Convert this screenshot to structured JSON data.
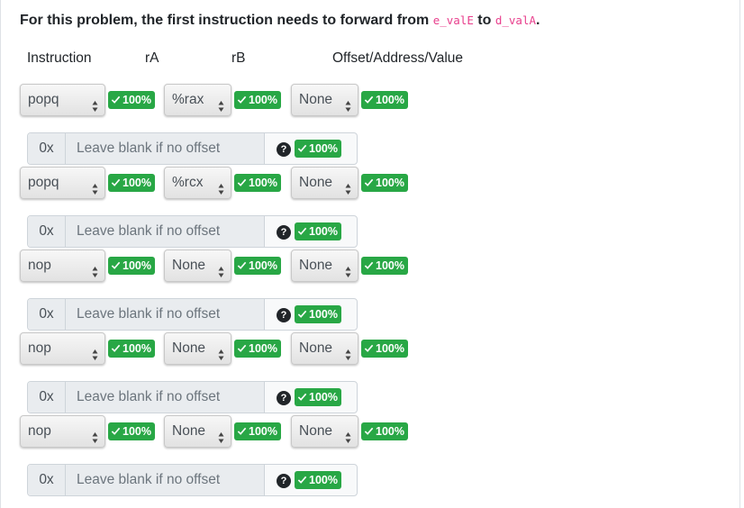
{
  "title": {
    "prefix": "For this problem, the first instruction needs to forward from ",
    "from_code": "e_valE",
    "mid": " to ",
    "to_code": "d_valA",
    "suffix": "."
  },
  "headers": {
    "instruction": "Instruction",
    "ra": "rA",
    "rb": "rB",
    "offset": "Offset/Address/Value"
  },
  "rows": [
    {
      "instruction": "popq",
      "ra": "%rax",
      "rb": "None",
      "offset_prefix": "0x",
      "offset_value": "",
      "offset_placeholder": "Leave blank if no offset",
      "badge_instruction": "100%",
      "badge_ra": "100%",
      "badge_rb": "100%",
      "badge_offset": "100%"
    },
    {
      "instruction": "popq",
      "ra": "%rcx",
      "rb": "None",
      "offset_prefix": "0x",
      "offset_value": "",
      "offset_placeholder": "Leave blank if no offset",
      "badge_instruction": "100%",
      "badge_ra": "100%",
      "badge_rb": "100%",
      "badge_offset": "100%"
    },
    {
      "instruction": "nop",
      "ra": "None",
      "rb": "None",
      "offset_prefix": "0x",
      "offset_value": "",
      "offset_placeholder": "Leave blank if no offset",
      "badge_instruction": "100%",
      "badge_ra": "100%",
      "badge_rb": "100%",
      "badge_offset": "100%"
    },
    {
      "instruction": "nop",
      "ra": "None",
      "rb": "None",
      "offset_prefix": "0x",
      "offset_value": "",
      "offset_placeholder": "Leave blank if no offset",
      "badge_instruction": "100%",
      "badge_ra": "100%",
      "badge_rb": "100%",
      "badge_offset": "100%"
    },
    {
      "instruction": "nop",
      "ra": "None",
      "rb": "None",
      "offset_prefix": "0x",
      "offset_value": "",
      "offset_placeholder": "Leave blank if no offset",
      "badge_instruction": "100%",
      "badge_ra": "100%",
      "badge_rb": "100%",
      "badge_offset": "100%"
    }
  ],
  "help_glyph": "?",
  "icons": {
    "select_arrow": "up-down-arrows-icon",
    "badge_check": "checkmark-icon",
    "help": "question-circle-icon"
  },
  "colors": {
    "badge": "#28a745",
    "code": "#e83e8c",
    "help": "#212529"
  }
}
